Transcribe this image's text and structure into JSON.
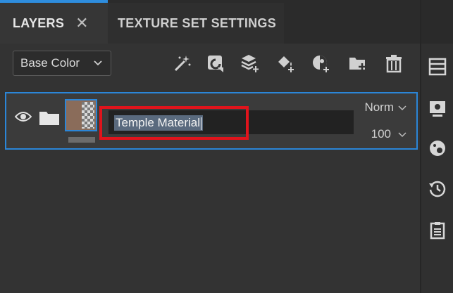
{
  "tabs": {
    "layers_label": "LAYERS",
    "close_symbol": "✕",
    "texture_set_label": "TEXTURE SET SETTINGS"
  },
  "toolbar": {
    "channel_value": "Base Color",
    "icons": [
      "magic-wand-icon",
      "add-layer-icon",
      "add-fill-layer-icon",
      "add-paint-icon",
      "add-mask-icon",
      "add-folder-icon",
      "delete-icon"
    ]
  },
  "layer": {
    "name": "Temple Material",
    "blend_mode": "Norm",
    "opacity": "100"
  },
  "sidebar": {
    "icons": [
      "layers-list-icon",
      "display-settings-icon",
      "shader-settings-icon",
      "history-icon",
      "log-icon"
    ]
  },
  "colors": {
    "accent": "#2b86d8",
    "highlight": "#e0141c",
    "panel": "#333333"
  }
}
